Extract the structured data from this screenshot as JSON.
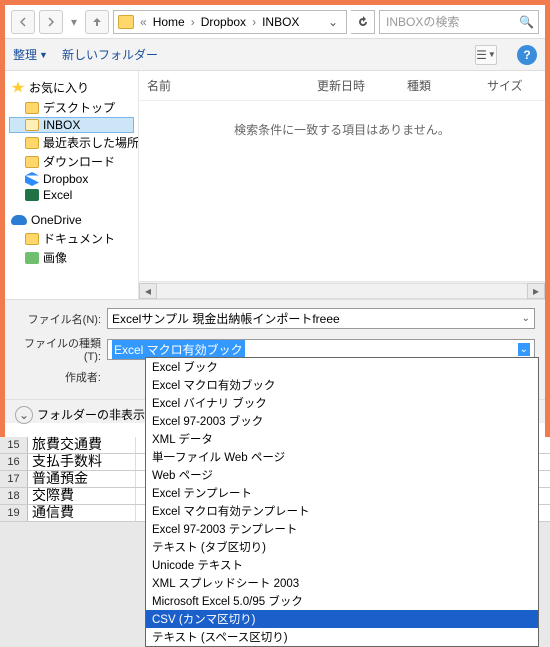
{
  "nav": {
    "breadcrumb": {
      "ellipsis": "«",
      "seg1": "Home",
      "seg2": "Dropbox",
      "seg3": "INBOX"
    },
    "search_placeholder": "INBOXの検索"
  },
  "cmdbar": {
    "organize": "整理",
    "new_folder": "新しいフォルダー"
  },
  "tree": {
    "favorites": "お気に入り",
    "fav_items": [
      "デスクトップ",
      "INBOX",
      "最近表示した場所",
      "ダウンロード",
      "Dropbox",
      "Excel"
    ],
    "onedrive": "OneDrive",
    "od_items": [
      "ドキュメント",
      "画像"
    ]
  },
  "columns": {
    "name": "名前",
    "date": "更新日時",
    "type": "種類",
    "size": "サイズ"
  },
  "content": {
    "empty": "検索条件に一致する項目はありません。"
  },
  "form": {
    "filename_label": "ファイル名(N):",
    "filename_value": "Excelサンプル 現金出納帳インポートfreee",
    "filetype_label": "ファイルの種類(T):",
    "filetype_value": "Excel マクロ有効ブック",
    "author_label": "作成者:"
  },
  "folderhide": "フォルダーの非表示",
  "filetype_options": [
    "Excel ブック",
    "Excel マクロ有効ブック",
    "Excel バイナリ ブック",
    "Excel 97-2003 ブック",
    "XML データ",
    "単一ファイル Web ページ",
    "Web ページ",
    "Excel テンプレート",
    "Excel マクロ有効テンプレート",
    "Excel 97-2003 テンプレート",
    "テキスト (タブ区切り)",
    "Unicode テキスト",
    "XML スプレッドシート 2003",
    "Microsoft Excel 5.0/95 ブック",
    "CSV (カンマ区切り)",
    "テキスト (スペース区切り)"
  ],
  "filetype_highlight_index": 14,
  "sheet_rows": [
    {
      "n": "15",
      "a": "旅費交通費"
    },
    {
      "n": "16",
      "a": "支払手数料"
    },
    {
      "n": "17",
      "a": "普通預金"
    },
    {
      "n": "18",
      "a": "交際費"
    },
    {
      "n": "19",
      "a": "通信費"
    }
  ]
}
